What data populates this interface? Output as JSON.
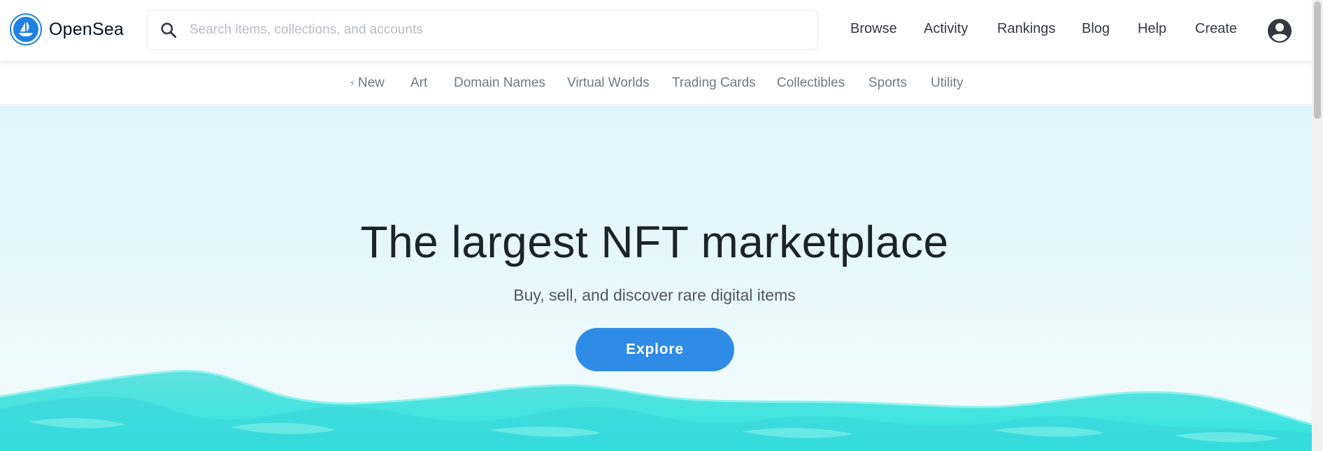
{
  "header": {
    "brand": "OpenSea",
    "search_placeholder": "Search items, collections, and accounts",
    "nav": [
      "Browse",
      "Activity",
      "Rankings",
      "Blog",
      "Help",
      "Create"
    ]
  },
  "categories": [
    "New",
    "Art",
    "Domain Names",
    "Virtual Worlds",
    "Trading Cards",
    "Collectibles",
    "Sports",
    "Utility"
  ],
  "hero": {
    "title": "The largest NFT marketplace",
    "subtitle": "Buy, sell, and discover rare digital items",
    "cta": "Explore"
  },
  "colors": {
    "brand_blue": "#2081e2",
    "cta_blue": "#2f8ce6",
    "hero_bg": "#dff5fb",
    "wave_teal": "#2ee6e0"
  },
  "icons": {
    "logo": "opensea-logo-icon",
    "search": "search-icon",
    "account": "account-circle-icon",
    "new": "lightning-bolt-icon"
  }
}
